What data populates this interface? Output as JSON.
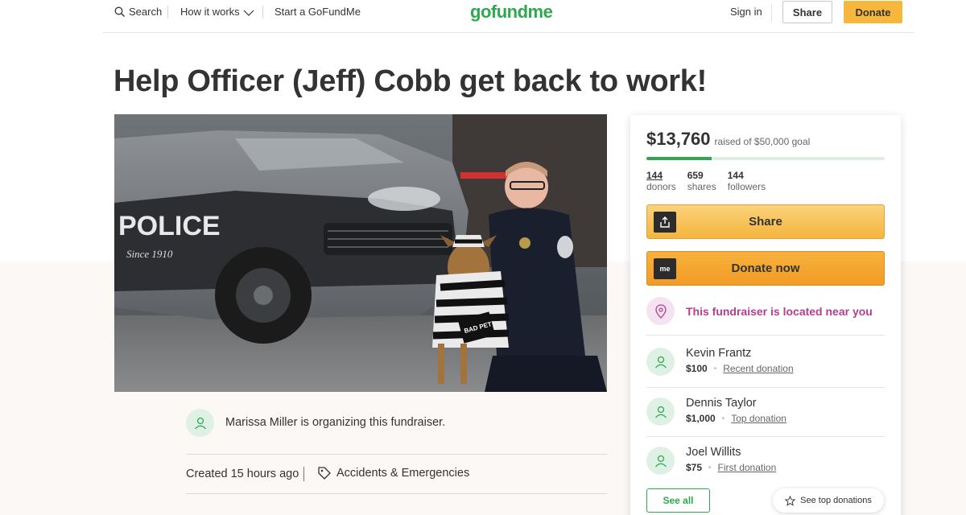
{
  "header": {
    "search_label": "Search",
    "how_label": "How it works",
    "start_label": "Start a GoFundMe",
    "logo_text": "gofundme",
    "signin_label": "Sign in",
    "share_label": "Share",
    "donate_label": "Donate"
  },
  "campaign": {
    "title": "Help Officer (Jeff) Cobb get back to work!",
    "organizer_text": "Marissa Miller is organizing this fundraiser.",
    "created": "Created 15 hours ago",
    "category": "Accidents & Emergencies"
  },
  "panel": {
    "raised_amount": "$13,760",
    "raised_of": "raised of $50,000 goal",
    "progress_fraction": 0.275,
    "stats": [
      {
        "number": "144",
        "label": "donors"
      },
      {
        "number": "659",
        "label": "shares"
      },
      {
        "number": "144",
        "label": "followers"
      }
    ],
    "share_label": "Share",
    "donate_label": "Donate now",
    "donate_icon_text": "me",
    "near_text": "This fundraiser is located near you",
    "donations": [
      {
        "name": "Kevin Frantz",
        "amount": "$100",
        "kind": "Recent donation"
      },
      {
        "name": "Dennis Taylor",
        "amount": "$1,000",
        "kind": "Top donation"
      },
      {
        "name": "Joel Willits",
        "amount": "$75",
        "kind": "First donation"
      }
    ],
    "see_all_label": "See all",
    "see_top_label": "See top donations"
  },
  "hero": {
    "car_text": "POLICE",
    "car_motto": "Since 1910",
    "sign_text": "BAD PET"
  },
  "colors": {
    "brand_green": "#2fa84f",
    "donate_orange": "#f5b53d",
    "near_purple": "#b43e8f"
  }
}
